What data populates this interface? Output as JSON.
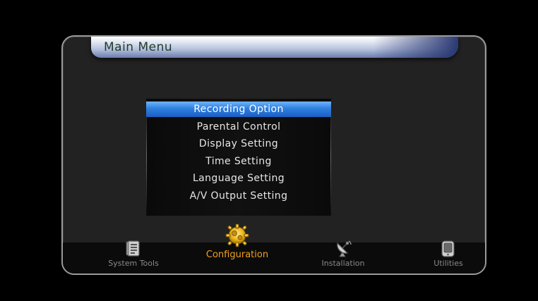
{
  "window": {
    "title": "Main Menu"
  },
  "menu": {
    "items": [
      {
        "label": "Recording Option",
        "selected": true
      },
      {
        "label": "Parental Control",
        "selected": false
      },
      {
        "label": "Display Setting",
        "selected": false
      },
      {
        "label": "Time Setting",
        "selected": false
      },
      {
        "label": "Language Setting",
        "selected": false
      },
      {
        "label": "A/V Output Setting",
        "selected": false
      }
    ],
    "highlight_color": "#2f7fe0"
  },
  "tabs": [
    {
      "label": "System Tools",
      "icon": "system-tools-icon",
      "active": false
    },
    {
      "label": "Configuration",
      "icon": "configuration-gear-icon",
      "active": true
    },
    {
      "label": "Installation",
      "icon": "satellite-dish-icon",
      "active": false
    },
    {
      "label": "Utilities",
      "icon": "handheld-device-icon",
      "active": false
    }
  ],
  "colors": {
    "active_tab": "#f0a020",
    "inactive_tab": "#8a8a8a"
  }
}
